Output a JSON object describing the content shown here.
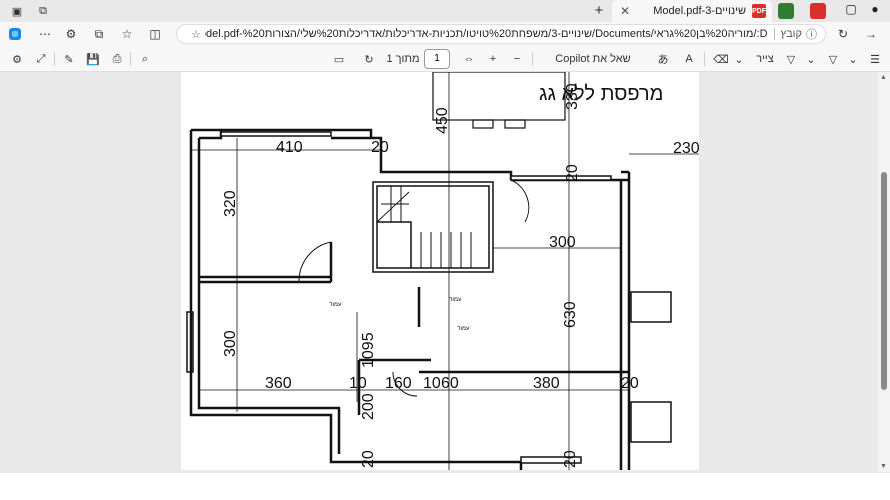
{
  "browser": {
    "tab_title": "שינויים-Model.pdf-3",
    "tab_badge": "PDF",
    "new_tab": "+",
    "address": {
      "label": "קובץ",
      "url": "D:/מוריה%20בן%20גראי/Documents/שינויים-3/משפחת%20טויטו/תכניות-אדריכלות/אדריכלות%20שלי/הצורות%20-Model.pdf"
    }
  },
  "pdf_toolbar": {
    "page_label": "מתוך 1",
    "page_value": "1",
    "copilot_label": "שאל את Copilot",
    "draw_label": "צייר",
    "zoom_in": "+",
    "zoom_out": "−"
  },
  "plan": {
    "title": "מרפסת ללא גג",
    "dimensions": [
      "410",
      "20",
      "320",
      "300",
      "300",
      "630",
      "360",
      "10",
      "160",
      "10",
      "60",
      "380",
      "20",
      "200",
      "20",
      "20",
      "230",
      "450",
      "330",
      "20",
      "1095"
    ],
    "column_label": "עמוד"
  },
  "colors": {
    "pdf_badge": "#d9302c",
    "page_bg": "#ffffff",
    "doc_bg": "#e9e9e9"
  }
}
